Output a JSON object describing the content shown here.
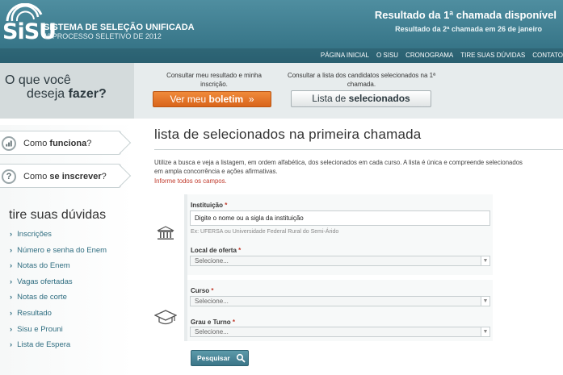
{
  "header": {
    "logo_text": "SiSU",
    "brand_title": "SISTEMA DE SELEÇÃO UNIFICADA",
    "brand_subtitle": "1º PROCESSO SELETIVO DE 2012",
    "announcement_main": "Resultado da 1ª chamada disponível",
    "announcement_sub": "Resultado da 2ª chamada em 26 de janeiro"
  },
  "topnav": [
    {
      "label": "PÁGINA INICIAL"
    },
    {
      "label": "O SISU"
    },
    {
      "label": "CRONOGRAMA"
    },
    {
      "label": "TIRE SUAS DÚVIDAS"
    },
    {
      "label": "CONTATO"
    }
  ],
  "question": {
    "line1": "O que você",
    "line2_prefix": "deseja ",
    "line2_bold": "fazer?"
  },
  "options": {
    "boletim_desc": "Consultar meu resultado e minha inscrição.",
    "boletim_prefix": "Ver meu ",
    "boletim_bold": "boletim",
    "boletim_arrow": "»",
    "lista_desc": "Consultar a lista dos candidatos selecionados na 1ª chamada.",
    "lista_prefix": "Lista de ",
    "lista_bold": "selecionados"
  },
  "sidebar": {
    "como_funciona_prefix": "Como ",
    "como_funciona_bold": "funciona",
    "como_funciona_suffix": "?",
    "como_inscrever_prefix": "Como ",
    "como_inscrever_bold": "se inscrever",
    "como_inscrever_suffix": "?",
    "inscrever_icon_glyph": "?",
    "faq_title": "tire suas dúvidas",
    "faq_items": [
      {
        "label": "Inscrições"
      },
      {
        "label": "Número e senha do Enem"
      },
      {
        "label": "Notas do Enem"
      },
      {
        "label": "Vagas ofertadas"
      },
      {
        "label": "Notas de corte"
      },
      {
        "label": "Resultado"
      },
      {
        "label": "Sisu e Prouni"
      },
      {
        "label": "Lista de Espera"
      }
    ]
  },
  "main": {
    "title": "lista de selecionados na primeira chamada",
    "intro_line1": "Utilize a busca e veja a listagem, em ordem alfabética, dos selecionados em cada curso. A lista é única e compreende selecionados",
    "intro_line2": "em ampla concorrência e ações afirmativas.",
    "required_note": "Informe todos os campos."
  },
  "form": {
    "instituicao_label": "Instituição",
    "required_mark": "*",
    "instituicao_value": "Digite o nome ou a sigla da instituição",
    "instituicao_hint": "Ex: UFERSA ou Universidade Federal Rural do Semi-Árido",
    "local_label": "Local de oferta",
    "local_value": "Selecione...",
    "curso_label": "Curso",
    "curso_value": "Selecione...",
    "grau_label": "Grau e Turno",
    "grau_value": "Selecione...",
    "caret_glyph": "▼",
    "search_label": "Pesquisar"
  },
  "colors": {
    "header": "#2f6d80",
    "accent_orange": "#e0732a",
    "required_red": "#c0392b"
  },
  "icons": [
    "sisu-logo-arc",
    "bar-chart-icon",
    "question-icon",
    "institution-icon",
    "graduation-cap-icon",
    "search-icon"
  ]
}
